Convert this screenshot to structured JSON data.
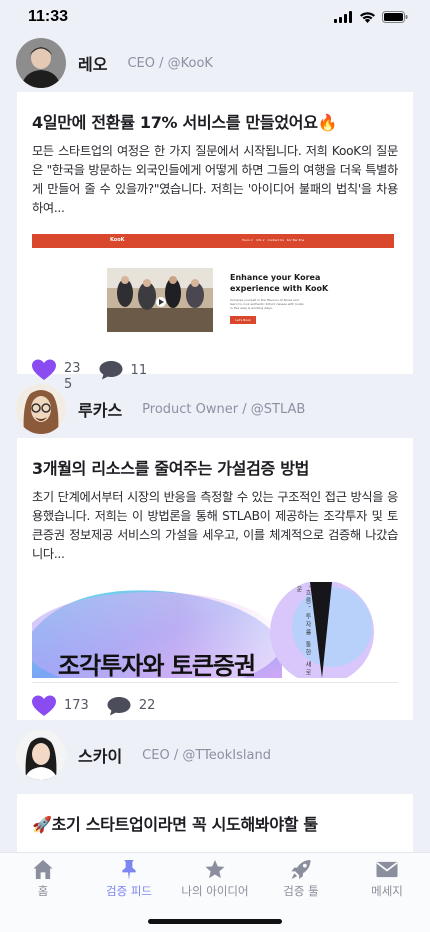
{
  "status": {
    "time": "11:33"
  },
  "posts": [
    {
      "author": "레오",
      "role": "CEO / @KooK",
      "title": "4일만에 전환률 17% 서비스를 만들었어요🔥",
      "body": "모든 스타트업의 여정은 한 가지 질문에서 시작됩니다. 저희 KooK의 질문은 \"한국을 방문하는 외국인들에게 어떻게 하면 그들의 여행을 더욱 특별하게 만들어 줄 수 있을까?\"였습니다. 저희는 '아이디어 불패의 법칙'을 차용하여...",
      "image": {
        "brand": "KooK",
        "nav": "Tours ∨   Info ∨   Contact Us   Kor Ber Ens",
        "headline_1": "Enhance your Korea",
        "headline_2": "experience with KooK",
        "subtext": "Immerse yourself in the flavours of Korea and learn to cook authentic K-food classes with locals in five easy & exciting ways.",
        "cta": "Let's Book"
      },
      "likes": "23\n5",
      "comments": "11"
    },
    {
      "author": "루카스",
      "role": "Product Owner / @STLAB",
      "title": "3개월의 리소스를 줄여주는 가설검증 방법",
      "body": "초기 단계에서부터 시장의 반응을 측정할 수 있는 구조적인 접근 방식을 응용했습니다. 저희는 이 방법론을 통해 STLAB이 제공하는 조각투자 및 토큰증권 정보제공 서비스의 가설을 세우고, 이를 체계적으로 검증해 나갔습니다...",
      "image": {
        "headline": "조각투자와 토큰증권",
        "side_text": "'흐름' 투자를 통한 새로운"
      },
      "likes": "173",
      "comments": "22"
    },
    {
      "author": "스카이",
      "role": "CEO / @TTeokIsland",
      "title": "🚀초기 스타트업이라면 꼭 시도해봐야할 툴"
    }
  ],
  "tabs": [
    {
      "label": "홈",
      "icon": "home-icon"
    },
    {
      "label": "검증 피드",
      "icon": "pin-icon",
      "active": true
    },
    {
      "label": "나의 아이디어",
      "icon": "star-icon"
    },
    {
      "label": "검증 툴",
      "icon": "rocket-icon"
    },
    {
      "label": "메세지",
      "icon": "mail-icon"
    }
  ],
  "colors": {
    "accent": "#7c86f0",
    "heart": "#8a4cf0",
    "brand_red": "#d9482c"
  }
}
